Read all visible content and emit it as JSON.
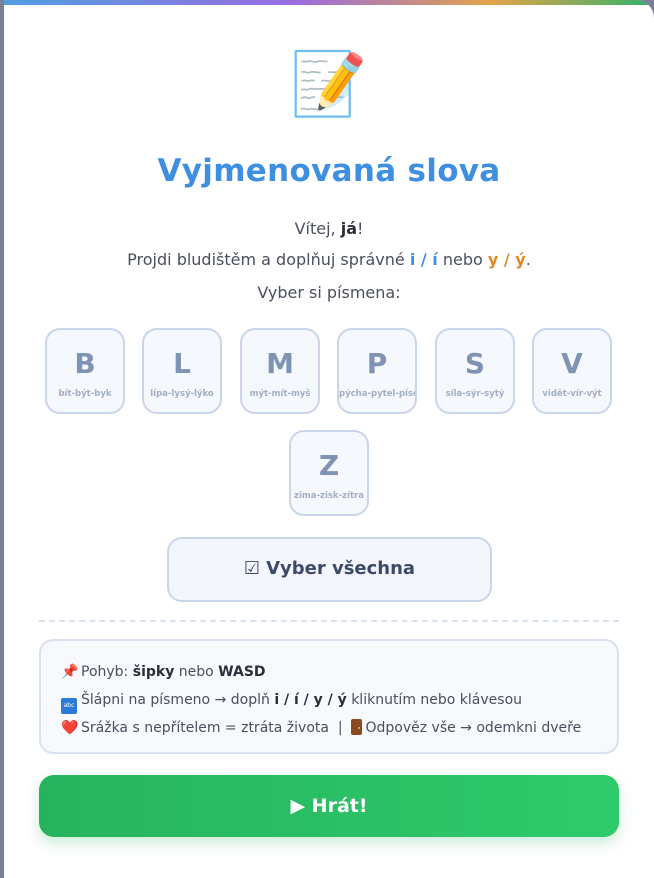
{
  "header": {
    "emoji": "📝",
    "title": "Vyjmenovaná slova"
  },
  "intro": {
    "greeting_prefix": "Vítej, ",
    "player_name": "já",
    "greeting_suffix": "!",
    "instruction_prefix": "Projdi bludištěm a doplňuj správné ",
    "option_i": "i / í",
    "connector": " nebo ",
    "option_y": "y / ý",
    "instruction_suffix": ".",
    "choose_prompt": "Vyber si písmena:"
  },
  "letters": [
    {
      "letter": "B",
      "hint": "bít-být-byk"
    },
    {
      "letter": "L",
      "hint": "lípa-lysý-lýko"
    },
    {
      "letter": "M",
      "hint": "mýt-mít-myš"
    },
    {
      "letter": "P",
      "hint": "pýcha-pytel-písek"
    },
    {
      "letter": "S",
      "hint": "síla-sýr-sytý"
    },
    {
      "letter": "V",
      "hint": "vidět-vír-výt"
    },
    {
      "letter": "Z",
      "hint": "zima-zisk-zítra"
    }
  ],
  "select_all": {
    "icon": "☑",
    "label": "Vyber všechna"
  },
  "info": {
    "move_icon": "📌",
    "move_prefix": "Pohyb: ",
    "move_keys1": "šipky",
    "move_mid": " nebo ",
    "move_keys2": "WASD",
    "step_icon_text": "abc",
    "step_prefix": "Šlápni na písmeno → doplň ",
    "step_options": "i / í / y / ý",
    "step_suffix": " kliknutím nebo klávesou",
    "heart_icon": "❤️",
    "collision_text": "Srážka s nepřítelem = ztráta života",
    "separator": "|",
    "door_text": "Odpověz vše → odemkni dveře"
  },
  "play_button": {
    "label": "▶ Hrát!"
  },
  "colors": {
    "title": "#3f8fe0",
    "accent_blue": "#3f8fe0",
    "accent_orange": "#e08a1e",
    "play_green": "#2ecb6b",
    "card_border": "#c9d6ea"
  }
}
